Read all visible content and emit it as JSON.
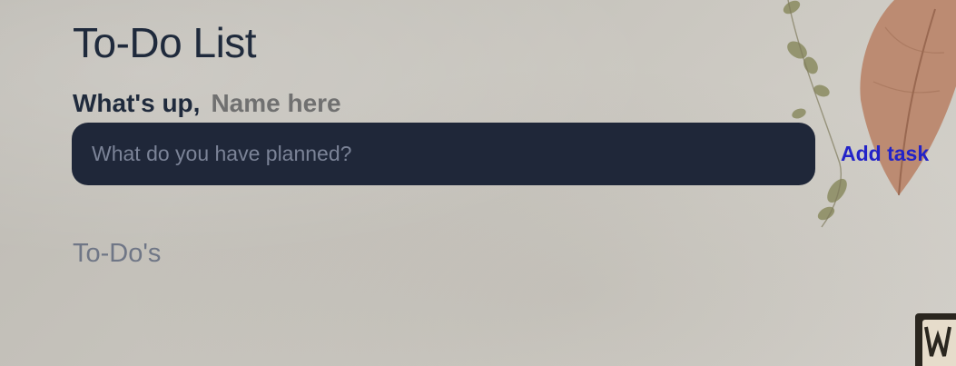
{
  "header": {
    "title": "To-Do List"
  },
  "greeting": {
    "label": "What's up,",
    "name_placeholder": "Name here"
  },
  "new_task": {
    "placeholder": "What do you have planned?",
    "value": "",
    "add_label": "Add task"
  },
  "todos": {
    "heading": "To-Do's",
    "items": []
  },
  "colors": {
    "title": "#1f2a3c",
    "input_background": "#1f2739",
    "add_button": "#2323c8",
    "section_heading": "#6f7686"
  }
}
